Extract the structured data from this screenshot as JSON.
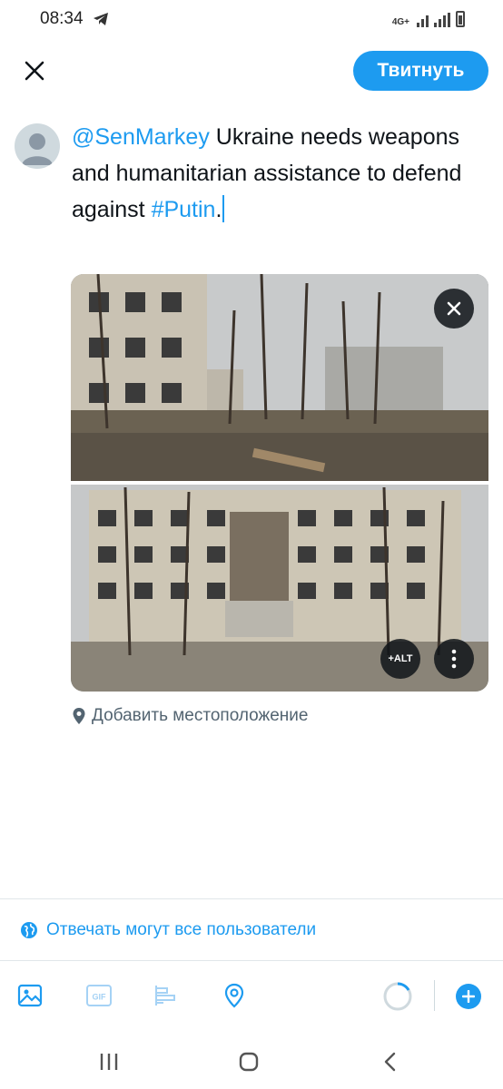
{
  "status_bar": {
    "time": "08:34",
    "network": "4G+",
    "icons": [
      "telegram-icon",
      "signal-icon",
      "signal-icon",
      "battery-icon"
    ]
  },
  "header": {
    "close_icon": "close-icon",
    "tweet_button_label": "Твитнуть"
  },
  "composer": {
    "mention": "@SenMarkey",
    "text": " Ukraine needs weapons and humanitarian assistance to defend against ",
    "hashtag": "#Putin",
    "trailing": "."
  },
  "media": {
    "description": "",
    "alt_label": "+ALT",
    "remove_icon": "close-icon",
    "more_icon": "more-vertical-icon"
  },
  "location": {
    "label": "Добавить местоположение",
    "icon": "location-pin-icon"
  },
  "reply_setting": {
    "label": "Отвечать могут все пользователи",
    "icon": "globe-icon"
  },
  "toolbar": {
    "items": [
      "image-icon",
      "gif-icon",
      "poll-icon",
      "location-icon"
    ],
    "gif_label": "GIF",
    "add_icon": "plus-icon"
  },
  "nav_bar": {
    "items": [
      "recent-apps-icon",
      "home-icon",
      "back-icon"
    ]
  },
  "colors": {
    "accent": "#1d9bf0",
    "text": "#0f1419",
    "muted": "#536471"
  }
}
